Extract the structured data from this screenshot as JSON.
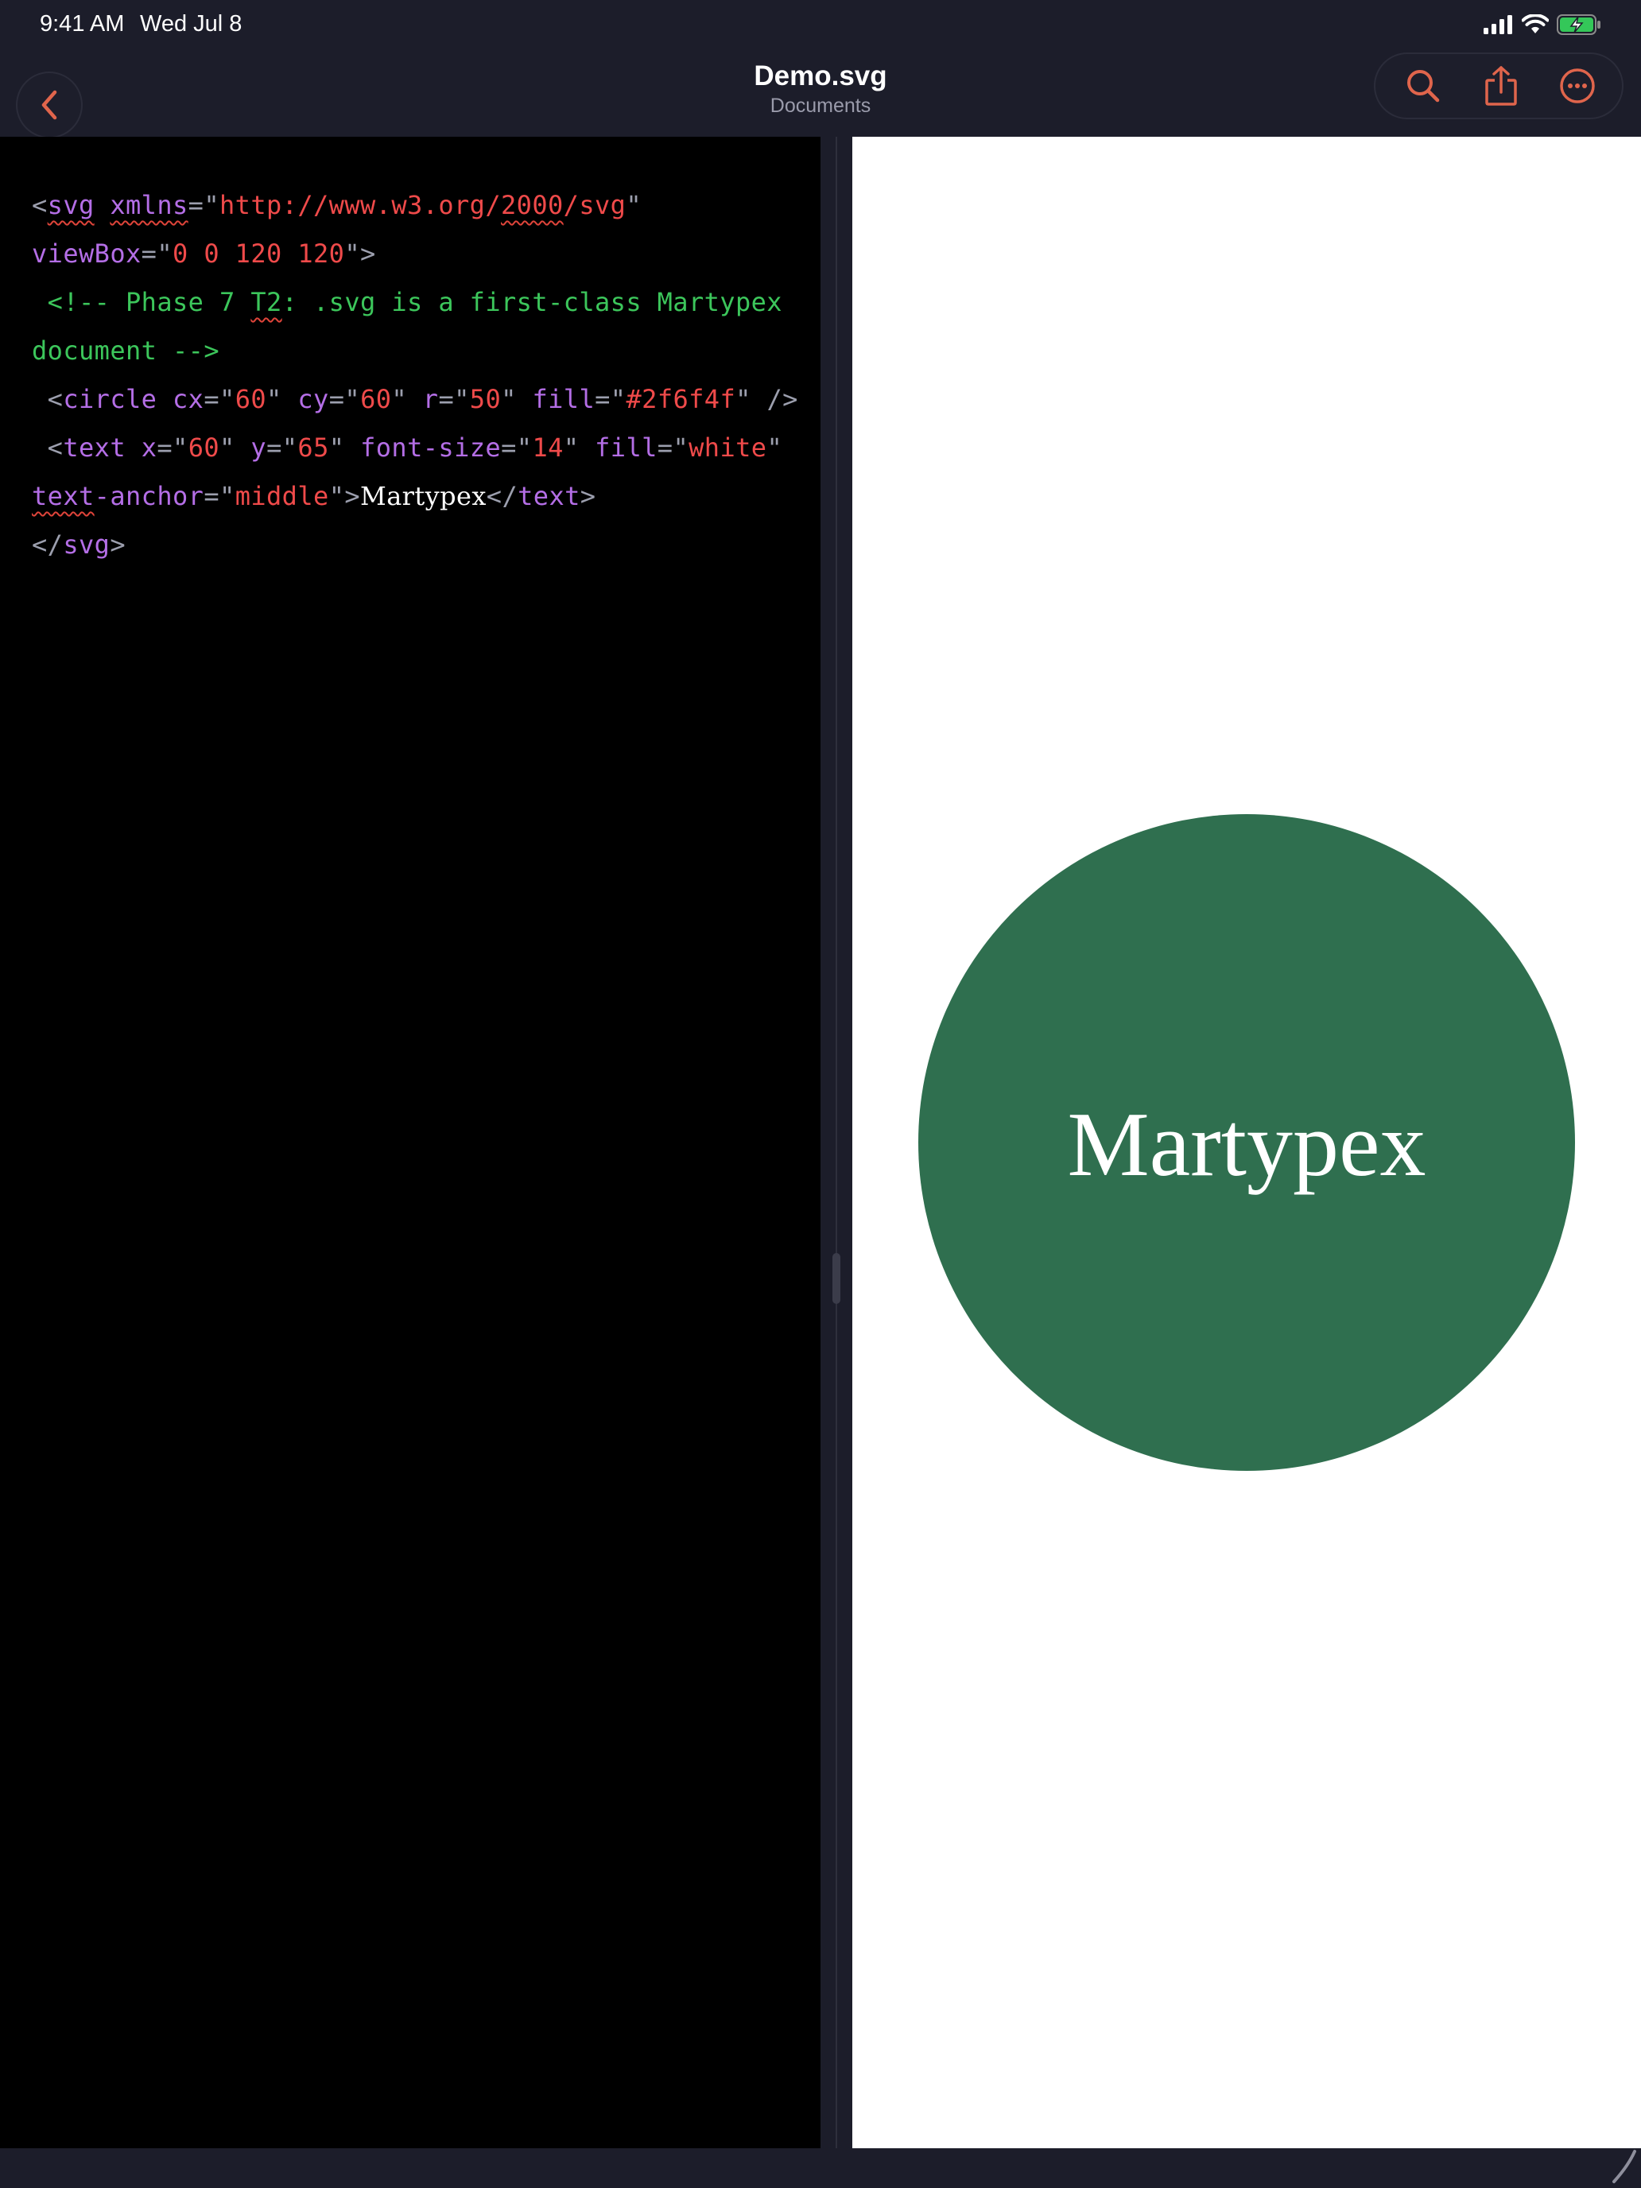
{
  "status_bar": {
    "time": "9:41 AM",
    "date": "Wed Jul 8"
  },
  "nav": {
    "title": "Demo.svg",
    "subtitle": "Documents"
  },
  "editor": {
    "line1": {
      "open": "<",
      "tag": "svg",
      "attr1": "xmlns",
      "eq": "=\"",
      "value1_a": "http://www.w3.org/",
      "value1_b": "2000",
      "value1_c": "/svg",
      "close_q": "\"",
      "attr2": "viewBox",
      "value2": "0 0 120 120",
      "end": "\">"
    },
    "comment": {
      "a": "<!-- Phase 7 ",
      "b": "T2",
      "c": ": .svg is a first-class Martypex document -->"
    },
    "circle_line": {
      "open": "<",
      "tag": "circle",
      "attrs": [
        {
          "name": "cx",
          "value": "60"
        },
        {
          "name": "cy",
          "value": "60"
        },
        {
          "name": "r",
          "value": "50"
        },
        {
          "name": "fill",
          "value": "#2f6f4f"
        }
      ],
      "end": " />"
    },
    "text_line": {
      "open": "<",
      "tag": "text",
      "attrs": [
        {
          "name": "x",
          "value": "60"
        },
        {
          "name": "y",
          "value": "65"
        },
        {
          "name": "font-size",
          "value": "14"
        },
        {
          "name": "fill",
          "value": "white"
        }
      ],
      "anchor_attr": {
        "a": "text",
        "b": "-anchor",
        "value": "middle"
      },
      "content": "Martypex",
      "close_open": "</",
      "close_tag": "text",
      "close_end": ">"
    },
    "svg_close": {
      "open": "</",
      "tag": "svg",
      "end": ">"
    }
  },
  "preview": {
    "circle_fill": "#2f6f4f",
    "text": "Martypex",
    "text_fill": "#ffffff"
  },
  "colors": {
    "accent": "#e0654c",
    "background": "#1c1d2a",
    "tag": "#b46ee6",
    "value": "#ef4a4a",
    "comment": "#3cc65b"
  }
}
